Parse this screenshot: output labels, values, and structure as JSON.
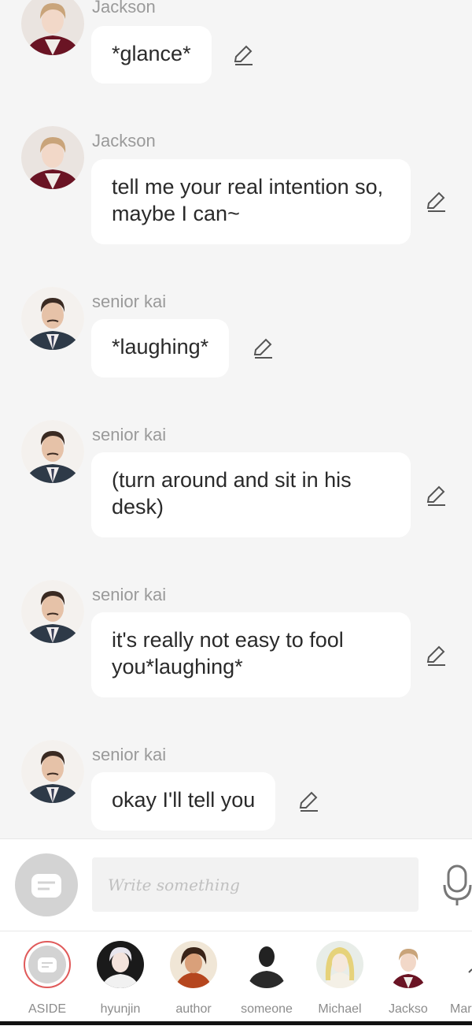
{
  "messages": [
    {
      "name": "Jackson",
      "text": "*glance*"
    },
    {
      "name": "Jackson",
      "text": "tell me your real intention so, maybe I can~"
    },
    {
      "name": "senior kai",
      "text": "*laughing*"
    },
    {
      "name": "senior kai",
      "text": "(turn around and sit in his desk)"
    },
    {
      "name": "senior kai",
      "text": "it's really not easy to fool you*laughing*"
    },
    {
      "name": "senior kai",
      "text": "okay I'll tell you"
    }
  ],
  "composer": {
    "placeholder": "Write something",
    "aside_icon": "chat-bubble-icon",
    "mic_icon": "microphone-icon"
  },
  "characters": [
    {
      "label": "ASIDE",
      "selected": true
    },
    {
      "label": "hyunjin"
    },
    {
      "label": "author"
    },
    {
      "label": "someone"
    },
    {
      "label": "Michael"
    },
    {
      "label": "Jackson"
    },
    {
      "label": "Mar"
    }
  ],
  "colors": {
    "background": "#f5f5f5",
    "bubble": "#ffffff",
    "selected_ring": "#e05a5a"
  }
}
